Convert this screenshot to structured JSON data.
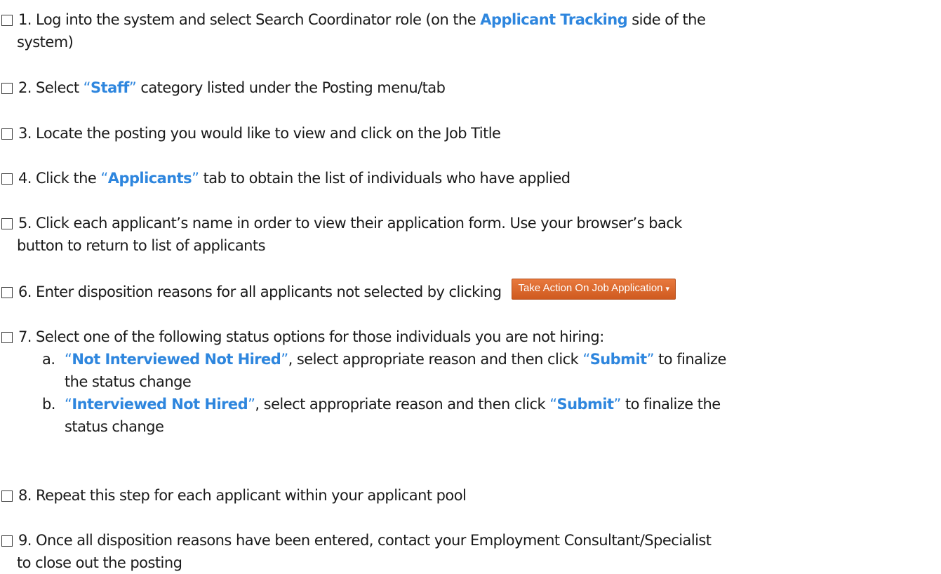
{
  "steps": [
    {
      "lead": "1. Log into the system and select Search Coordinator role (on the ",
      "hl": "Applicant Tracking",
      "tail": " side of the",
      "cont": "system)"
    },
    {
      "lead": "2. Select ",
      "hl": "Staff",
      "tail": " category listed under the Posting menu/tab"
    },
    {
      "text": "3. Locate the posting you would like to view and click on the Job Title"
    },
    {
      "lead": "4. Click the ",
      "hl": "Applicants",
      "tail": " tab to obtain the list of individuals who have applied"
    },
    {
      "text": "5. Click each applicant’s name in order to view their application form. Use your browser’s back",
      "cont": "button to return to list of applicants"
    },
    {
      "text": "6. Enter disposition reasons for all applicants not selected by clicking",
      "button": "Take Action On Job Application",
      "caret": "▾"
    },
    {
      "text": "7. Select one of the following status options for those individuals you are not hiring:",
      "subs": [
        {
          "label": "a.",
          "hl": "Not Interviewed Not Hired",
          "mid": ", select appropriate reason and then click ",
          "hl2": "Submit",
          "tail": " to finalize",
          "cont": "the status change"
        },
        {
          "label": "b.",
          "hl": "Interviewed Not Hired",
          "mid": ", select appropriate reason and then click ",
          "hl2": "Submit",
          "tail": " to finalize the",
          "cont": "status change"
        }
      ]
    },
    {
      "text": "8. Repeat this step for each applicant within your applicant pool"
    },
    {
      "text": "9. Once all disposition reasons have been entered, contact your Employment Consultant/Specialist",
      "cont": "to close out the posting"
    }
  ],
  "quote_open": "“",
  "quote_close": "”",
  "colors": {
    "highlight": "#2e86de",
    "button": "#e06a2c"
  }
}
